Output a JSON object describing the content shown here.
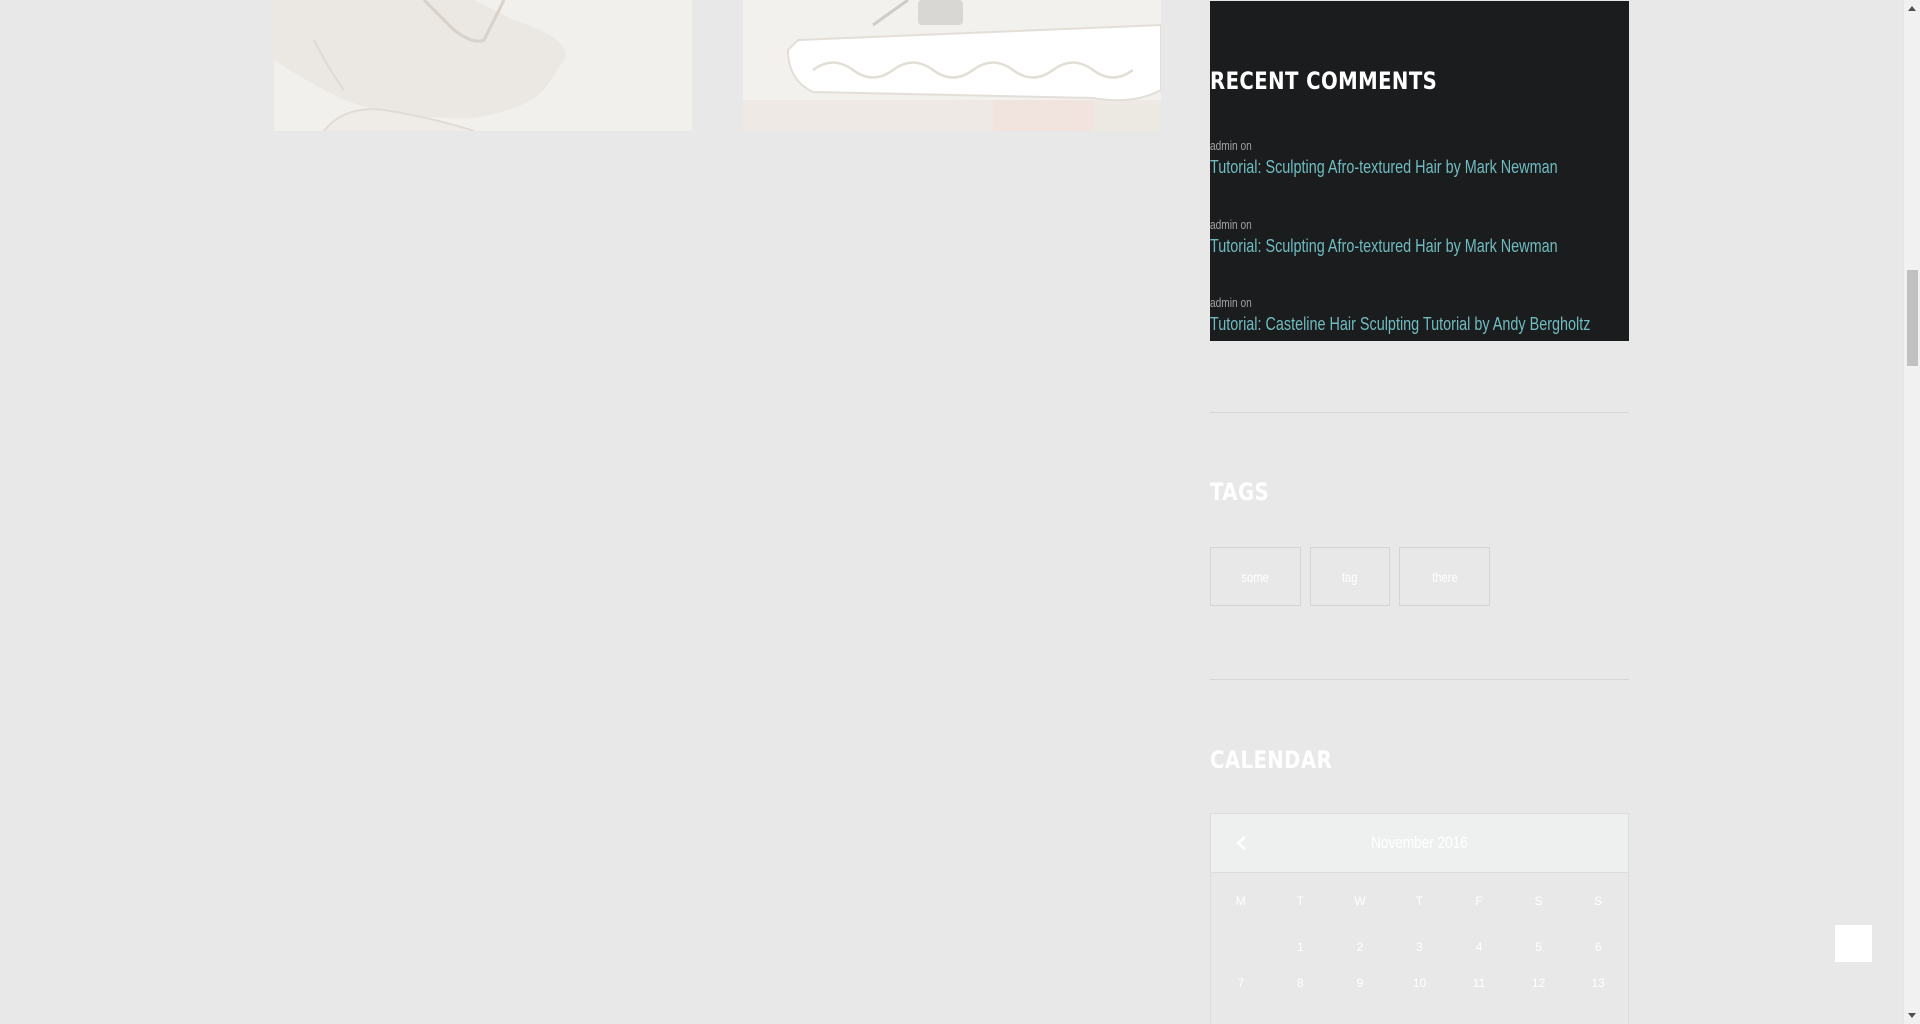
{
  "sidebar": {
    "recent_comments": {
      "title": "RECENT COMMENTS",
      "items": [
        {
          "author": "admin",
          "on": "on",
          "post": "Tutorial: Sculpting Afro-textured Hair by Mark Newman"
        },
        {
          "author": "admin",
          "on": "on",
          "post": "Tutorial: Sculpting Afro-textured Hair by Mark Newman"
        },
        {
          "author": "admin",
          "on": "on",
          "post": "Tutorial: Casteline Hair Sculpting Tutorial by Andy Bergholtz"
        }
      ]
    },
    "tags": {
      "title": "TAGS",
      "items": [
        "some",
        "tag",
        "there"
      ]
    },
    "calendar": {
      "title": "CALENDAR",
      "caption": "November 2016",
      "weekdays": [
        "M",
        "T",
        "W",
        "T",
        "F",
        "S",
        "S"
      ],
      "weeks": [
        [
          "",
          "1",
          "2",
          "3",
          "4",
          "5",
          "6"
        ],
        [
          "7",
          "8",
          "9",
          "10",
          "11",
          "12",
          "13"
        ]
      ]
    }
  },
  "icons": {
    "calendar_prev": "chevron-left-icon",
    "back_to_top": "back-to-top-icon"
  },
  "colors": {
    "page_background": "#e8e8e8",
    "widget_dark": "#1b1c1e",
    "link_accent": "#6fbcc0"
  }
}
